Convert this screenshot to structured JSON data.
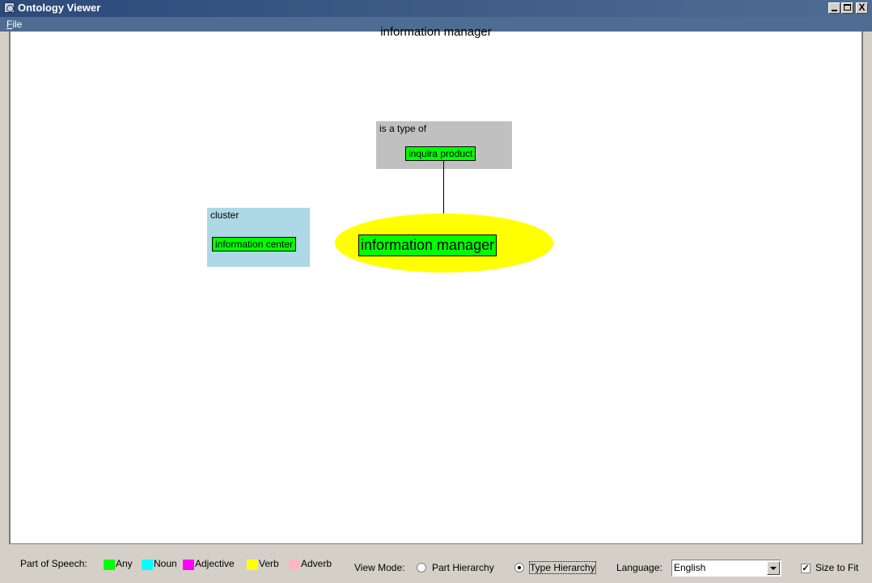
{
  "window": {
    "title": "Ontology Viewer",
    "close_glyph": "X"
  },
  "menu": {
    "file_label": "File"
  },
  "graph": {
    "title": "information manager",
    "center_node": "information manager",
    "groups": [
      {
        "label": "is a type of",
        "color": "#c0c0c0",
        "nodes": [
          "inquira product"
        ]
      },
      {
        "label": "cluster",
        "color": "#add8e6",
        "nodes": [
          "information center"
        ]
      }
    ],
    "center_color": "#ffff00",
    "node_color": "#00ff00"
  },
  "statusbar": {
    "pos_label": "Part of Speech:",
    "pos_legend": [
      {
        "label": "Any",
        "color": "#00ff00"
      },
      {
        "label": "Noun",
        "color": "#00ffff"
      },
      {
        "label": "Adjective",
        "color": "#ff00ff"
      },
      {
        "label": "Verb",
        "color": "#ffff00"
      },
      {
        "label": "Adverb",
        "color": "#ffb6c1"
      }
    ],
    "view_mode_label": "View Mode:",
    "view_modes": [
      {
        "label": "Part Hierarchy",
        "selected": false
      },
      {
        "label": "Type Hierarchy",
        "selected": true
      }
    ],
    "language_label": "Language:",
    "language_value": "English",
    "size_to_fit_label": "Size to Fit",
    "size_to_fit_checked": true,
    "check_glyph": "✓"
  }
}
